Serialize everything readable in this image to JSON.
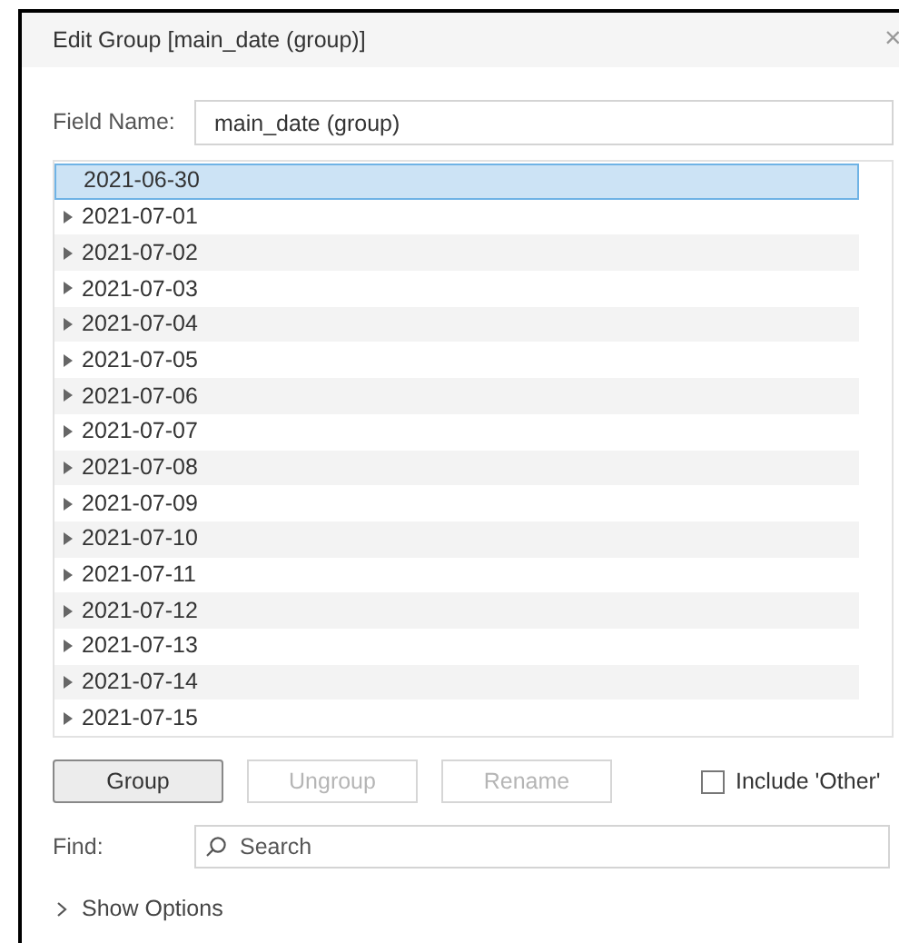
{
  "window": {
    "title": "Edit Group [main_date (group)]",
    "close": "×"
  },
  "field_name": {
    "label": "Field Name:",
    "value": "main_date (group)"
  },
  "items": [
    {
      "label": "2021-06-30",
      "expandable": false,
      "selected": true
    },
    {
      "label": "2021-07-01",
      "expandable": true,
      "selected": false
    },
    {
      "label": "2021-07-02",
      "expandable": true,
      "selected": false
    },
    {
      "label": "2021-07-03",
      "expandable": true,
      "selected": false
    },
    {
      "label": "2021-07-04",
      "expandable": true,
      "selected": false
    },
    {
      "label": "2021-07-05",
      "expandable": true,
      "selected": false
    },
    {
      "label": "2021-07-06",
      "expandable": true,
      "selected": false
    },
    {
      "label": "2021-07-07",
      "expandable": true,
      "selected": false
    },
    {
      "label": "2021-07-08",
      "expandable": true,
      "selected": false
    },
    {
      "label": "2021-07-09",
      "expandable": true,
      "selected": false
    },
    {
      "label": "2021-07-10",
      "expandable": true,
      "selected": false
    },
    {
      "label": "2021-07-11",
      "expandable": true,
      "selected": false
    },
    {
      "label": "2021-07-12",
      "expandable": true,
      "selected": false
    },
    {
      "label": "2021-07-13",
      "expandable": true,
      "selected": false
    },
    {
      "label": "2021-07-14",
      "expandable": true,
      "selected": false
    },
    {
      "label": "2021-07-15",
      "expandable": true,
      "selected": false
    }
  ],
  "buttons": [
    {
      "label": "Group",
      "disabled": false
    },
    {
      "label": "Ungroup",
      "disabled": true
    },
    {
      "label": "Rename",
      "disabled": true
    }
  ],
  "include_other": {
    "label": "Include 'Other'",
    "checked": false
  },
  "find": {
    "label": "Find:",
    "placeholder": "Search"
  },
  "show_options": {
    "label": "Show Options",
    "expanded": false
  }
}
